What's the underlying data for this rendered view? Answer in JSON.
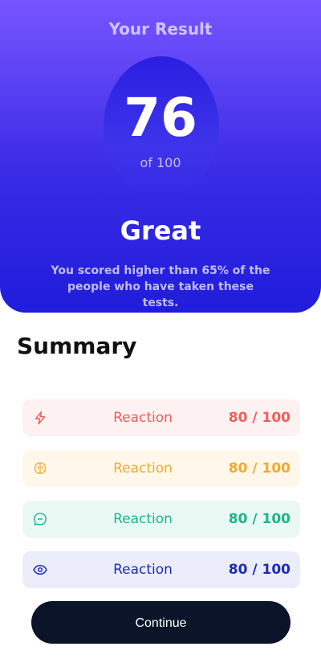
{
  "result": {
    "title": "Your Result",
    "score": "76",
    "score_max": "of 100",
    "rating": "Great",
    "description": "You scored higher than 65% of the people who have taken these tests."
  },
  "summary": {
    "heading": "Summary",
    "items": [
      {
        "label": "Reaction",
        "score": "80",
        "max": " / 100",
        "icon": "lightning-icon",
        "color": "#f25c5c"
      },
      {
        "label": "Reaction",
        "score": "80",
        "max": " / 100",
        "icon": "brain-icon",
        "color": "#f2aa2c"
      },
      {
        "label": "Reaction",
        "score": "80",
        "max": " / 100",
        "icon": "chat-bubble-icon",
        "color": "#1bb589"
      },
      {
        "label": "Reaction",
        "score": "80",
        "max": " / 100",
        "icon": "eye-icon",
        "color": "#1f2bb3"
      }
    ]
  },
  "actions": {
    "continue_label": "Continue"
  },
  "colors": {
    "gradient_top": "#7755ff",
    "gradient_bottom": "#1f1ddb",
    "button_bg": "#0b1428"
  }
}
